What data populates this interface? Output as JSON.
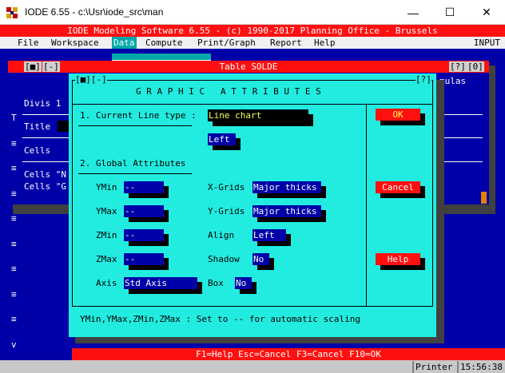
{
  "window": {
    "title": "IODE 6.55 - c:\\Usr\\iode_src\\man",
    "minimize": "—",
    "maximize": "☐",
    "close": "✕",
    "icon": "iode-app-icon"
  },
  "header": {
    "text": "IODE Modeling Software 6.55 - (c) 1990-2017 Planning Office - Brussels"
  },
  "menu": {
    "items": [
      {
        "label": "File",
        "active": false
      },
      {
        "label": "Workspace",
        "active": false
      },
      {
        "label": "Data",
        "active": true
      },
      {
        "label": "Compute",
        "active": false
      },
      {
        "label": "Print/Graph",
        "active": false
      },
      {
        "label": "Report",
        "active": false
      },
      {
        "label": "Help",
        "active": false
      }
    ],
    "mode": "INPUT"
  },
  "table_window": {
    "title": "Table SOLDE",
    "left_buttons": [
      "[■]",
      "[-]"
    ],
    "right_buttons": [
      "[?]",
      "[0]"
    ],
    "rows": [
      "Divis 1",
      "Title",
      "Cells",
      "Cells \"N",
      "Cells \"G"
    ],
    "right_fragment": "mulas",
    "scroll_marks": [
      "T",
      "≡",
      "≡",
      "≡",
      "≡",
      "≡",
      "≡",
      "≡",
      "≡",
      "v"
    ]
  },
  "dialog": {
    "left_buttons": "[■][-]",
    "help_button": "[?]",
    "title": "G R A P H I C   A T T R I B U T E S",
    "section1_label": "1. Current Line type :",
    "line_type_value": "Line chart",
    "align1_value": "Left",
    "section2_label": "2. Global Attributes",
    "labels": {
      "ymin": "YMin",
      "ymax": "YMax",
      "zmin": "ZMin",
      "zmax": "ZMax",
      "axis": "Axis",
      "xgrids": "X-Grids",
      "ygrids": "Y-Grids",
      "align": "Align",
      "shadow": "Shadow",
      "box": "Box"
    },
    "values": {
      "ymin": "--",
      "ymax": "--",
      "zmin": "--",
      "zmax": "--",
      "axis": "Std Axis",
      "xgrids": "Major thicks",
      "ygrids": "Major thicks",
      "align": "Left",
      "shadow": "No",
      "box": "No"
    },
    "buttons": {
      "ok": "OK",
      "cancel": "Cancel",
      "help": "Help"
    },
    "hint": "YMin,YMax,ZMin,ZMax : Set to -- for automatic scaling"
  },
  "fkeys": "F1=Help Esc=Cancel F3=Cancel F10=OK",
  "status": {
    "printer": "Printer",
    "time": "15:56:38"
  },
  "colors": {
    "console_blue": "#0000a8",
    "dialog_cyan": "#22ece0",
    "header_red": "#ff1010",
    "highlight_yellow": "#ffff55"
  }
}
